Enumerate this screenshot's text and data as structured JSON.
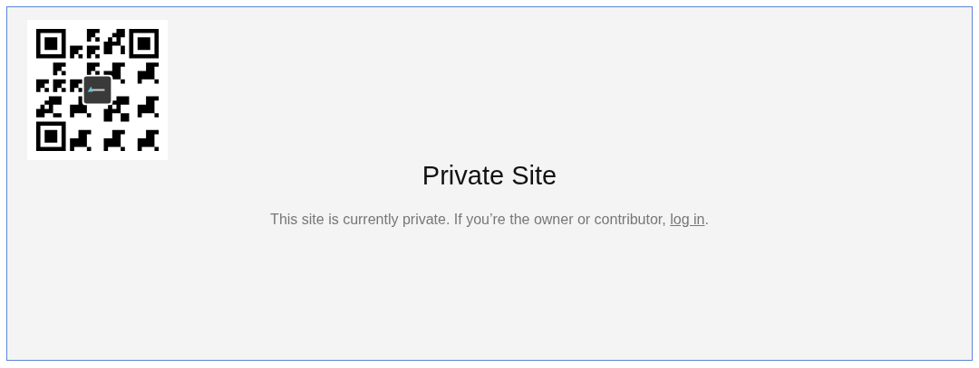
{
  "title": "Private Site",
  "message": {
    "text": "This site is currently private. If you’re the owner or contributor, ",
    "link": "log in",
    "end": "."
  }
}
